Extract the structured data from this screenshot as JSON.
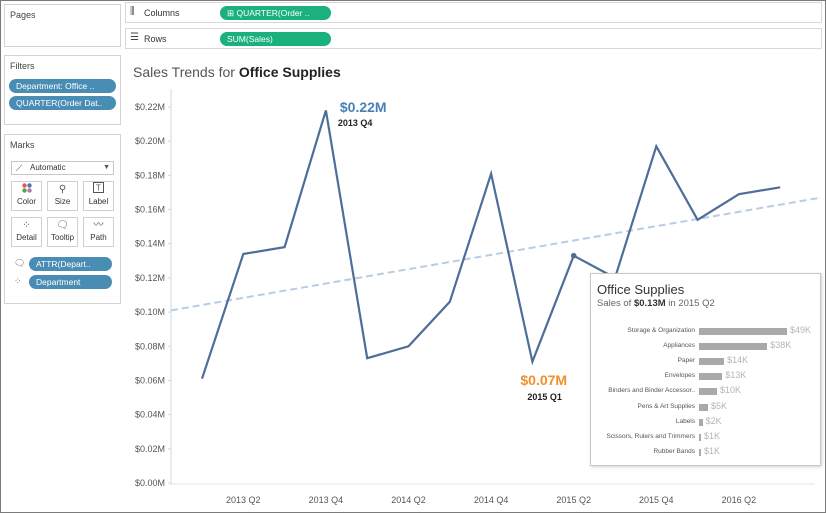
{
  "left_panel": {
    "pages_title": "Pages",
    "filters_title": "Filters",
    "filters": [
      "Department: Office ..",
      "QUARTER(Order Dat.."
    ],
    "marks_title": "Marks",
    "mark_type": "Automatic",
    "mark_buttons": [
      "Color",
      "Size",
      "Label",
      "Detail",
      "Tooltip",
      "Path"
    ],
    "mark_fields": [
      "ATTR(Depart..",
      "Department"
    ]
  },
  "shelves": {
    "columns_label": "Columns",
    "columns_pill": "⊞ QUARTER(Order ..",
    "rows_label": "Rows",
    "rows_pill": "SUM(Sales)"
  },
  "chart": {
    "title_prefix": "Sales Trends for ",
    "title_bold": "Office Supplies",
    "colors": {
      "line": "#4e6e99",
      "trend": "#b8cde4",
      "max_label": "#4a7fb8",
      "min_label": "#f0902b"
    },
    "max_annotation": {
      "value": "$0.22M",
      "period": "2013 Q4"
    },
    "min_annotation": {
      "value": "$0.07M",
      "period": "2015 Q1"
    }
  },
  "chart_data": {
    "type": "line",
    "title": "Sales Trends for Office Supplies",
    "xlabel": "",
    "ylabel": "",
    "x": [
      "2013 Q1",
      "2013 Q2",
      "2013 Q3",
      "2013 Q4",
      "2014 Q1",
      "2014 Q2",
      "2014 Q3",
      "2014 Q4",
      "2015 Q1",
      "2015 Q2",
      "2015 Q3",
      "2015 Q4",
      "2016 Q1",
      "2016 Q2",
      "2016 Q3"
    ],
    "x_tick_labels": [
      "2013 Q2",
      "2013 Q4",
      "2014 Q2",
      "2014 Q4",
      "2015 Q2",
      "2015 Q4",
      "2016 Q2"
    ],
    "series": [
      {
        "values": [
          0.061,
          0.134,
          0.138,
          0.218,
          0.073,
          0.08,
          0.106,
          0.181,
          0.071,
          0.133,
          0.12,
          0.197,
          0.154,
          0.169,
          0.173
        ]
      }
    ],
    "trend_line": {
      "start": 0.101,
      "end": 0.167
    },
    "y_ticks": [
      "$0.00M",
      "$0.02M",
      "$0.04M",
      "$0.06M",
      "$0.08M",
      "$0.10M",
      "$0.12M",
      "$0.14M",
      "$0.16M",
      "$0.18M",
      "$0.20M",
      "$0.22M"
    ],
    "ylim": [
      0,
      0.22
    ],
    "grid": false,
    "highlighted_point": "2015 Q2"
  },
  "tooltip": {
    "title": "Office Supplies",
    "sub_prefix": "Sales of ",
    "sub_value": "$0.13M",
    "sub_suffix": " in 2015 Q2",
    "rows": [
      {
        "name": "Storage & Organization",
        "value": "$49K",
        "amount": 49
      },
      {
        "name": "Appliances",
        "value": "$38K",
        "amount": 38
      },
      {
        "name": "Paper",
        "value": "$14K",
        "amount": 14
      },
      {
        "name": "Envelopes",
        "value": "$13K",
        "amount": 13
      },
      {
        "name": "Binders and Binder Accessor..",
        "value": "$10K",
        "amount": 10
      },
      {
        "name": "Pens & Art Supplies",
        "value": "$5K",
        "amount": 5
      },
      {
        "name": "Labels",
        "value": "$2K",
        "amount": 2
      },
      {
        "name": "Scissors, Rulers and Trimmers",
        "value": "$1K",
        "amount": 1
      },
      {
        "name": "Rubber Bands",
        "value": "$1K",
        "amount": 1
      }
    ]
  }
}
